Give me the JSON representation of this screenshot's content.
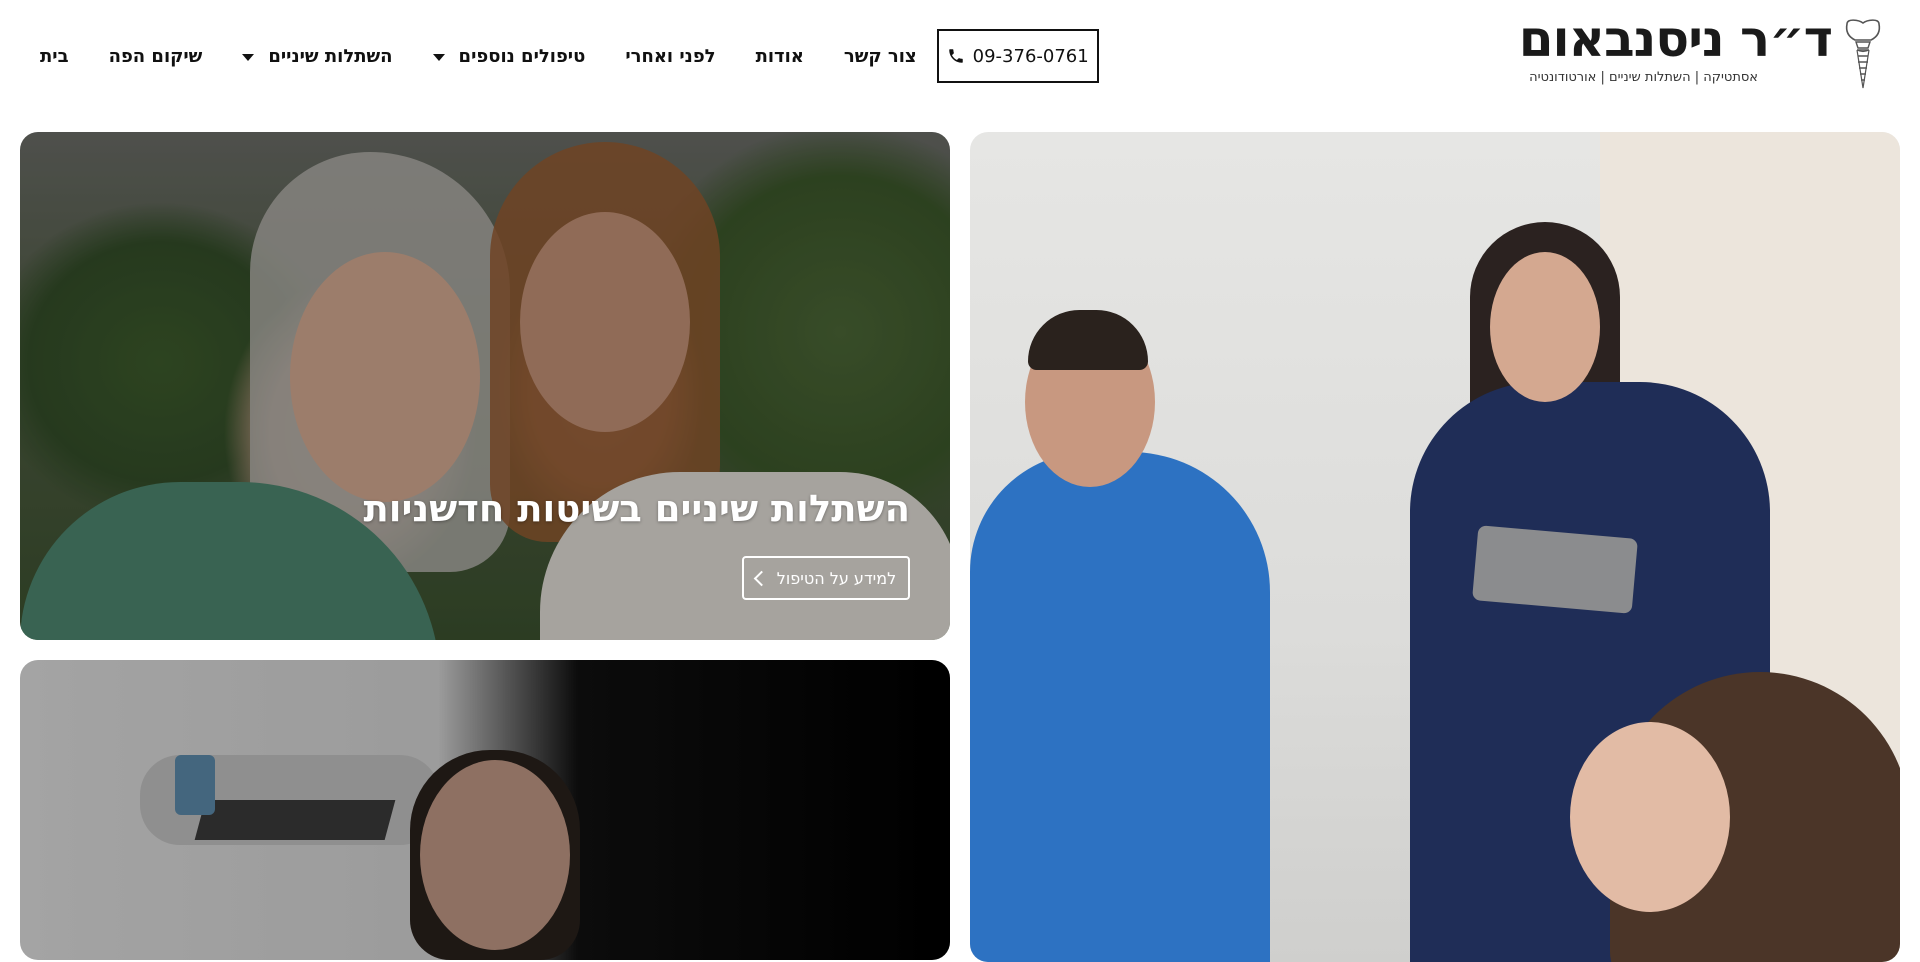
{
  "logo": {
    "title": "ד״ר ניסנבאום",
    "subtitle": "אסתטיקה | השתלות שיניים | אורטודונטיה"
  },
  "nav": {
    "items": [
      {
        "label": "בית",
        "dropdown": false
      },
      {
        "label": "שיקום הפה",
        "dropdown": false
      },
      {
        "label": "השתלות שיניים",
        "dropdown": true
      },
      {
        "label": "טיפולים נוספים",
        "dropdown": true
      },
      {
        "label": "לפני ואחרי",
        "dropdown": false
      },
      {
        "label": "אודות",
        "dropdown": false
      },
      {
        "label": "צור קשר",
        "dropdown": false
      }
    ],
    "phone": "09-376-0761"
  },
  "hero": {
    "card1": {
      "title": "השתלות שיניים בשיטות חדשניות",
      "button_label": "למידע על הטיפול"
    }
  },
  "colors": {
    "text": "#111111",
    "white": "#ffffff",
    "overlay": "rgba(0,0,0,0.28)"
  }
}
